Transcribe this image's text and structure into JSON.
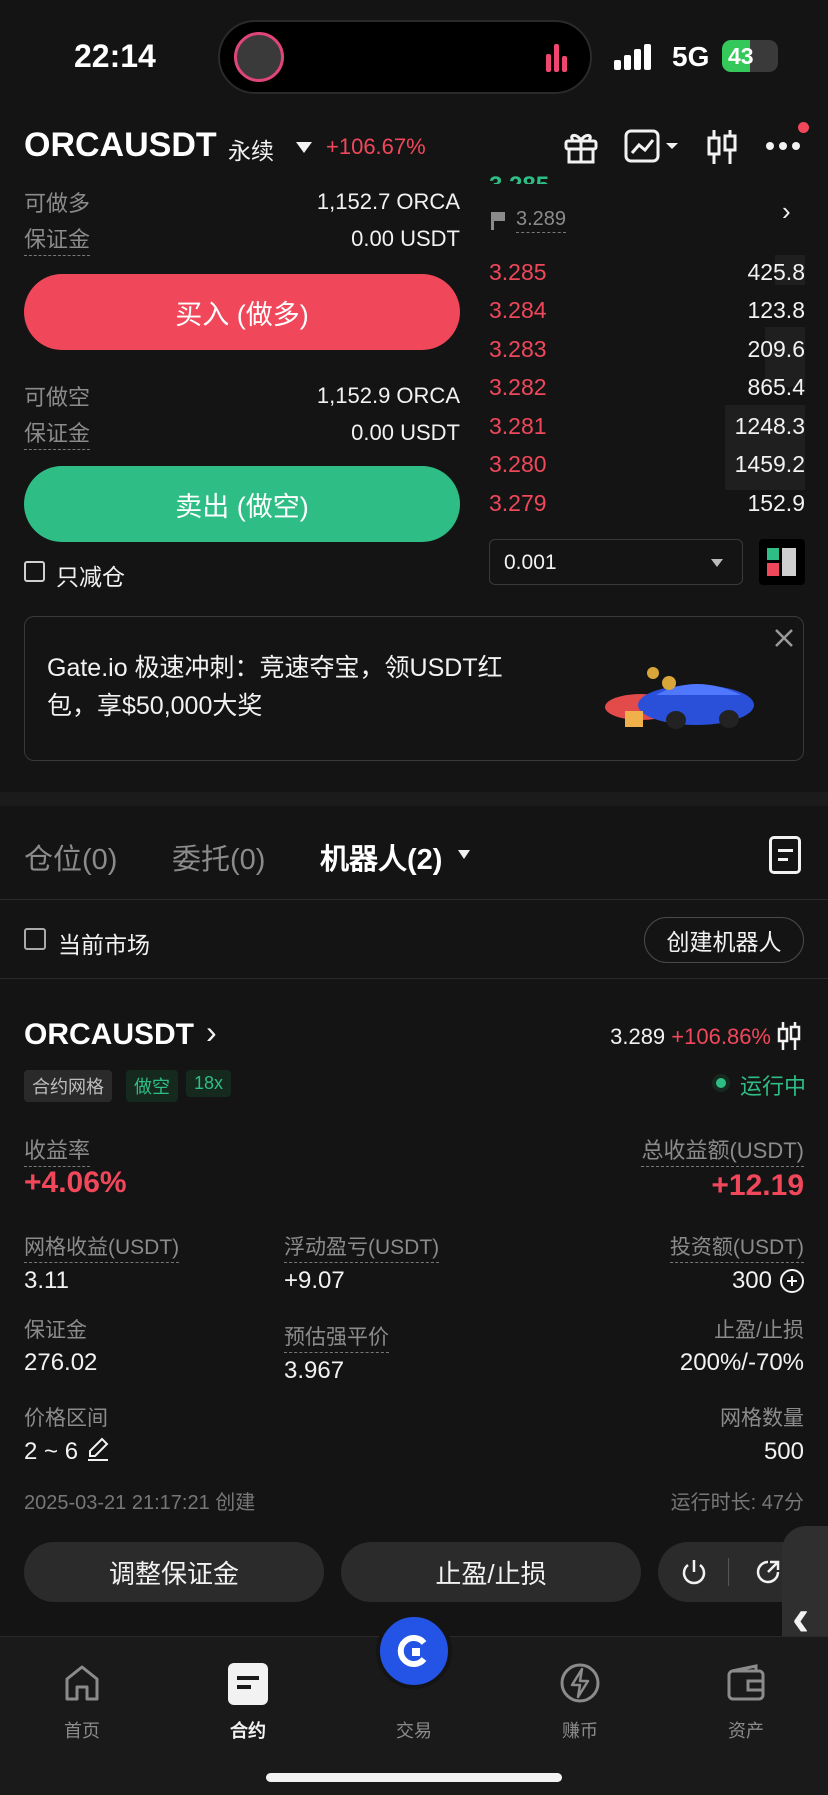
{
  "status_bar": {
    "time": "22:14",
    "network": "5G",
    "battery": "43"
  },
  "header": {
    "symbol": "ORCAUSDT",
    "contract_type": "永续",
    "change": "+106.67%"
  },
  "trade": {
    "long_label": "可做多",
    "long_value": "1,152.7 ORCA",
    "long_margin_label": "保证金",
    "long_margin_value": "0.00 USDT",
    "buy_button": "买入 (做多)",
    "short_label": "可做空",
    "short_value": "1,152.9 ORCA",
    "short_margin_label": "保证金",
    "short_margin_value": "0.00 USDT",
    "sell_button": "卖出 (做空)",
    "reduce_only": "只减仓"
  },
  "orderbook": {
    "mark_price": "3.289",
    "rows": [
      {
        "price": "3.285",
        "qty": "425.8"
      },
      {
        "price": "3.284",
        "qty": "123.8"
      },
      {
        "price": "3.283",
        "qty": "209.6"
      },
      {
        "price": "3.282",
        "qty": "865.4"
      },
      {
        "price": "3.281",
        "qty": "1248.3"
      },
      {
        "price": "3.280",
        "qty": "1459.2"
      },
      {
        "price": "3.279",
        "qty": "152.9"
      }
    ],
    "precision": "0.001"
  },
  "banner": {
    "text": "Gate.io 极速冲刺：竞速夺宝，领USDT红包，享$50,000大奖"
  },
  "tabs": {
    "positions": "仓位(0)",
    "orders": "委托(0)",
    "bots": "机器人(2)"
  },
  "filter": {
    "current_market": "当前市场",
    "create_bot": "创建机器人"
  },
  "bot": {
    "symbol": "ORCAUSDT",
    "price": "3.289",
    "change": "+106.86%",
    "tag_type": "合约网格",
    "tag_side": "做空",
    "tag_leverage": "18x",
    "status": "运行中",
    "return_rate_label": "收益率",
    "return_rate": "+4.06%",
    "total_profit_label": "总收益额(USDT)",
    "total_profit": "+12.19",
    "grid_profit_label": "网格收益(USDT)",
    "grid_profit": "3.11",
    "float_pnl_label": "浮动盈亏(USDT)",
    "float_pnl": "+9.07",
    "invest_label": "投资额(USDT)",
    "invest": "300",
    "margin_label": "保证金",
    "margin": "276.02",
    "liq_label": "预估强平价",
    "liq": "3.967",
    "tpsl_label": "止盈/止损",
    "tpsl": "200%/-70%",
    "range_label": "价格区间",
    "range": "2 ~ 6",
    "grids_label": "网格数量",
    "grids": "500",
    "created": "2025-03-21 21:17:21 创建",
    "runtime": "运行时长: 47分",
    "adjust_margin": "调整保证金",
    "tpsl_button": "止盈/止损"
  },
  "nav": {
    "home": "首页",
    "futures": "合约",
    "trade": "交易",
    "earn": "赚币",
    "assets": "资产"
  },
  "colors": {
    "red": "#f0475b",
    "green": "#2ebd85",
    "accent": "#2354e6"
  }
}
